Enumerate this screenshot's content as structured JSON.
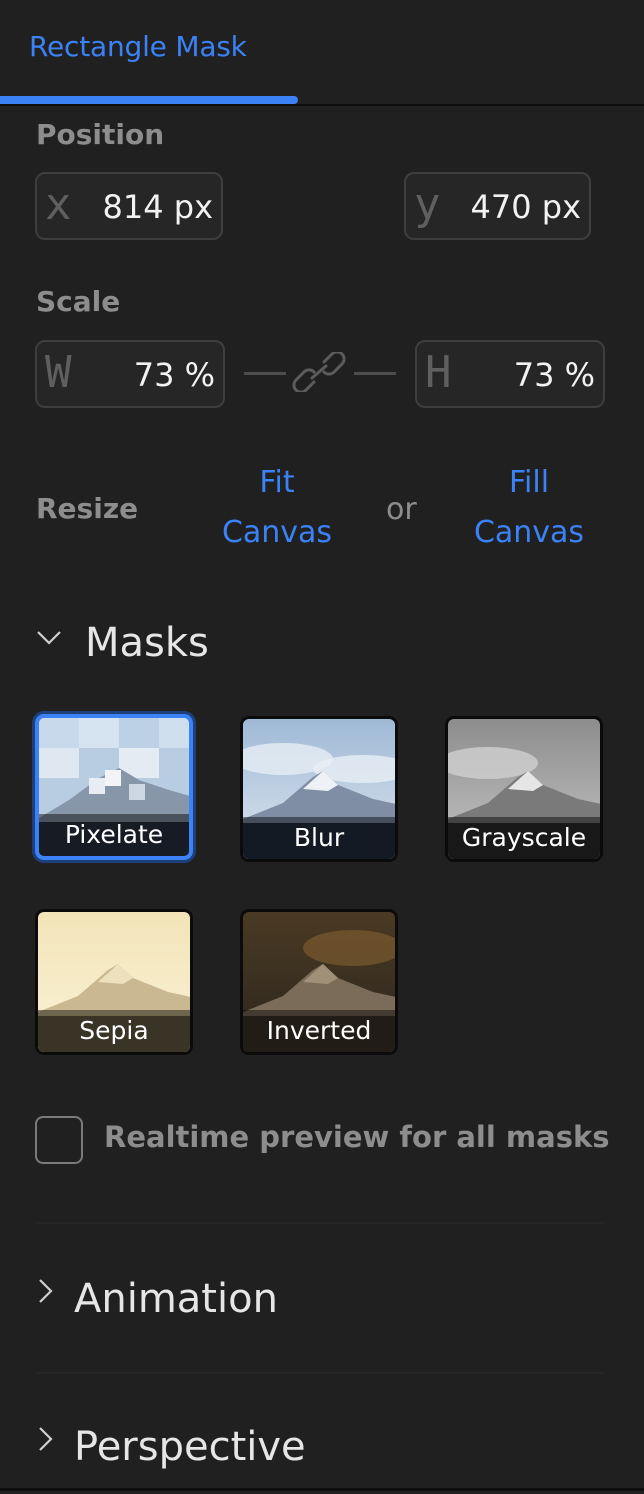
{
  "header": {
    "tab_label": "Rectangle Mask"
  },
  "position": {
    "label": "Position",
    "x": {
      "prefix": "x",
      "value": "814 px"
    },
    "y": {
      "prefix": "y",
      "value": "470 px"
    }
  },
  "scale": {
    "label": "Scale",
    "w": {
      "prefix": "W",
      "value": "73 %"
    },
    "h": {
      "prefix": "H",
      "value": "73 %"
    },
    "link_icon": "chain-link-icon"
  },
  "resize": {
    "label": "Resize",
    "fit_line1": "Fit",
    "fit_line2": "Canvas",
    "or": "or",
    "fill_line1": "Fill",
    "fill_line2": "Canvas"
  },
  "masks": {
    "title": "Masks",
    "expanded": true,
    "items": [
      {
        "label": "Pixelate",
        "selected": true
      },
      {
        "label": "Blur",
        "selected": false
      },
      {
        "label": "Grayscale",
        "selected": false
      },
      {
        "label": "Sepia",
        "selected": false
      },
      {
        "label": "Inverted",
        "selected": false
      }
    ]
  },
  "realtime_preview": {
    "label": "Realtime preview for all masks",
    "checked": false
  },
  "animation": {
    "title": "Animation",
    "expanded": false
  },
  "perspective": {
    "title": "Perspective",
    "expanded": false
  },
  "colors": {
    "accent": "#3b82f6",
    "panel_bg": "#202020",
    "muted_text": "#8d8d8d"
  }
}
